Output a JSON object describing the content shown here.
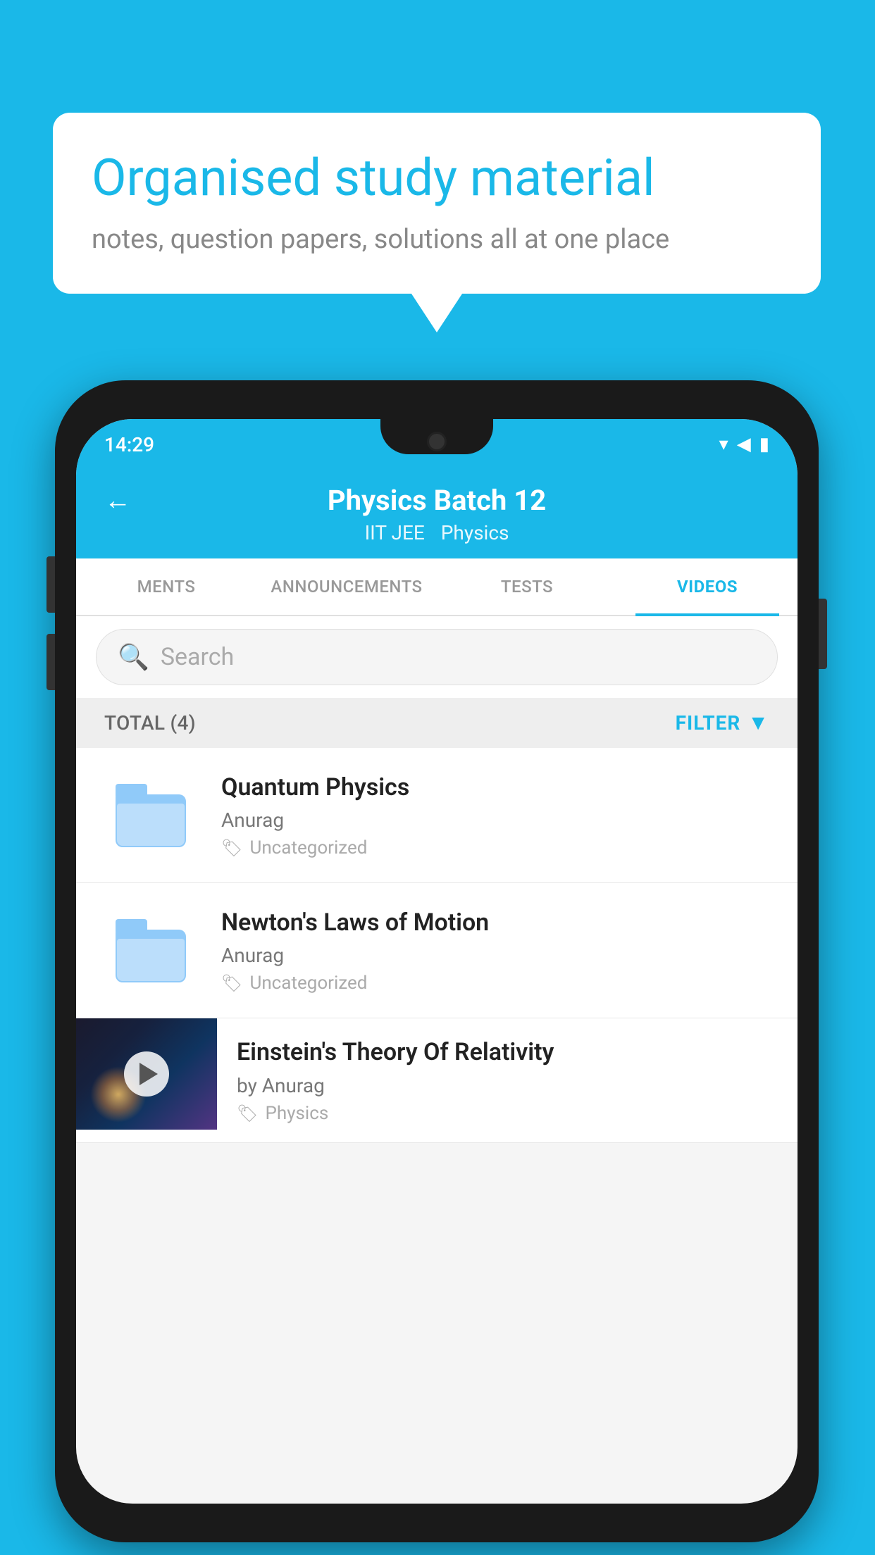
{
  "background_color": "#1ab8e8",
  "speech_bubble": {
    "title": "Organised study material",
    "subtitle": "notes, question papers, solutions all at one place"
  },
  "phone": {
    "status_bar": {
      "time": "14:29"
    },
    "header": {
      "title": "Physics Batch 12",
      "tags": [
        "IIT JEE",
        "Physics"
      ],
      "back_label": "←"
    },
    "tabs": [
      {
        "label": "MENTS",
        "active": false
      },
      {
        "label": "ANNOUNCEMENTS",
        "active": false
      },
      {
        "label": "TESTS",
        "active": false
      },
      {
        "label": "VIDEOS",
        "active": true
      }
    ],
    "search": {
      "placeholder": "Search"
    },
    "filter": {
      "total_label": "TOTAL (4)",
      "filter_label": "FILTER"
    },
    "videos": [
      {
        "title": "Quantum Physics",
        "author": "Anurag",
        "tag": "Uncategorized",
        "type": "folder",
        "has_thumb": false
      },
      {
        "title": "Newton's Laws of Motion",
        "author": "Anurag",
        "tag": "Uncategorized",
        "type": "folder",
        "has_thumb": false
      },
      {
        "title": "Einstein's Theory Of Relativity",
        "author": "by Anurag",
        "tag": "Physics",
        "type": "video",
        "has_thumb": true
      }
    ]
  }
}
